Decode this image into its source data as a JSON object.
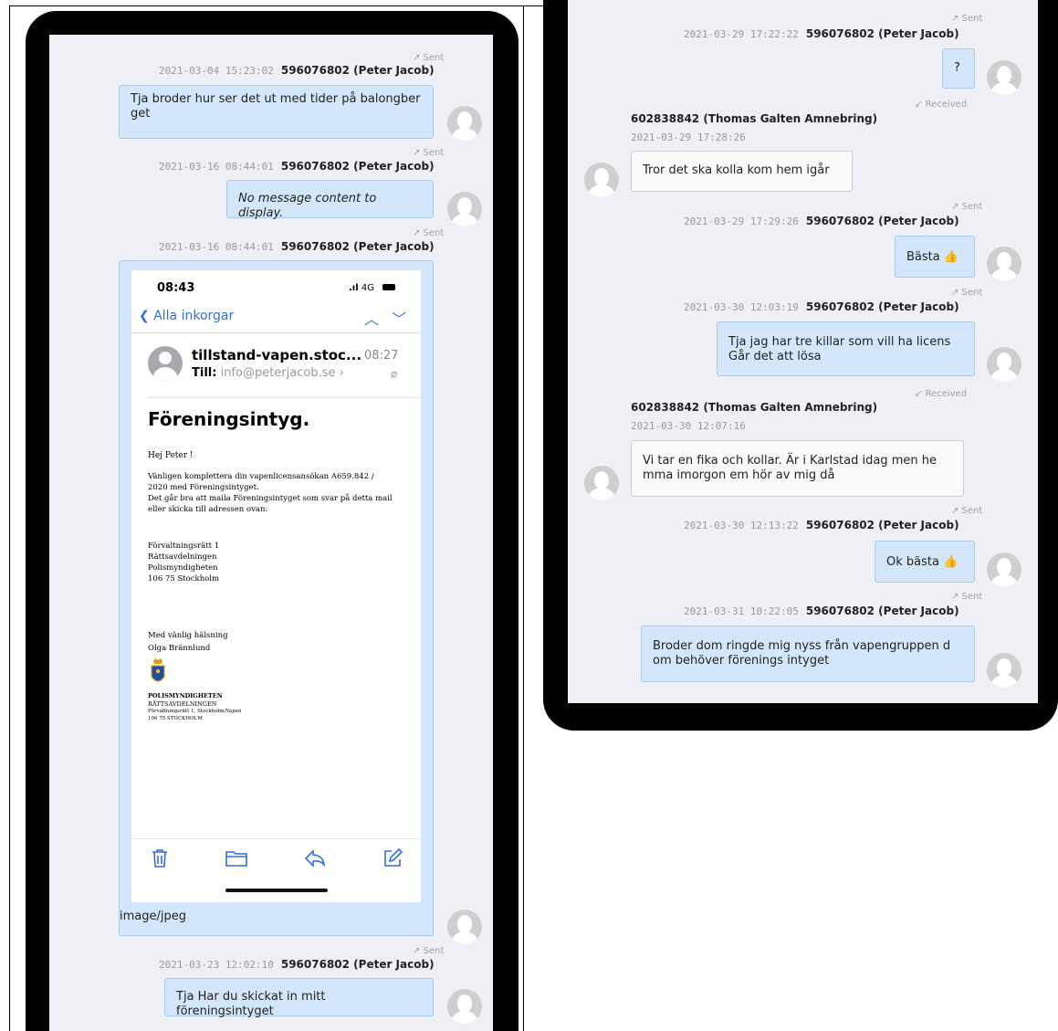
{
  "left": {
    "messages": [
      {
        "status": "↗ Sent",
        "timestamp": "2021-03-04 15:23:02",
        "sender": "596076802 (Peter Jacob)",
        "text": "Tja broder hur ser det ut med tider på balongber get"
      },
      {
        "status": "↗ Sent",
        "timestamp": "2021-03-16 08:44:01",
        "sender": "596076802 (Peter Jacob)",
        "text": "No message content to display."
      },
      {
        "status": "↗ Sent",
        "timestamp": "2021-03-16 08:44:01",
        "sender": "596076802 (Peter Jacob)",
        "attachment_type": "image/jpeg"
      },
      {
        "status": "↗ Sent",
        "timestamp": "2021-03-23 12:02:10",
        "sender": "596076802 (Peter Jacob)",
        "text": "Tja Har du skickat in mitt föreningsintyget"
      }
    ]
  },
  "mail": {
    "time": "08:43",
    "signal": "4G",
    "back_label": "Alla inkorgar",
    "from": "tillstand-vapen.stoc...",
    "from_time": "08:27",
    "to_label": "Till:",
    "to_value": "info@peterjacob.se",
    "subject": "Föreningsintyg.",
    "greeting": "Hej Peter !",
    "body_lines": [
      "Vänligen komplettera din vapenlicensansökan  A659.842 /",
      "2020  med  Föreningsintyget.",
      "Det går bra att maila Föreningsintyget som svar på detta mail",
      "eller skicka till adressen ovan:"
    ],
    "address_lines": [
      "Förvaltningsrätt 1",
      "Rättsavdelningen",
      "Polismyndigheten",
      "106 75 Stockholm"
    ],
    "closing": "Med vänlig hälsning",
    "signer": "Olga Brännlund",
    "org_name": "POLISMYNDIGHETEN",
    "org_dept": "RÄTTSAVDELNINGEN",
    "org_addr": "Förvaltningsrätt 1, Stockholm/Vapen",
    "org_city": "106 75 STOCKHOLM",
    "icons": [
      "trash-icon",
      "folder-icon",
      "reply-icon",
      "compose-icon"
    ]
  },
  "right": {
    "messages": [
      {
        "status": "↗ Sent",
        "timestamp": "2021-03-29 17:22:22",
        "sender": "596076802 (Peter Jacob)",
        "text": "?"
      },
      {
        "status": "↙ Received",
        "timestamp": "2021-03-29 17:28:26",
        "sender": "602838842 (Thomas Galten Amnebring)",
        "text": "Tror det ska kolla kom hem igår"
      },
      {
        "status": "↗ Sent",
        "timestamp": "2021-03-29 17:29:26",
        "sender": "596076802 (Peter Jacob)",
        "text": "Bästa 👍"
      },
      {
        "status": "↗ Sent",
        "timestamp": "2021-03-30 12:03:19",
        "sender": "596076802 (Peter Jacob)",
        "text": "Tja jag har tre killar som vill ha licens Går det att lösa"
      },
      {
        "status": "↙ Received",
        "timestamp": "2021-03-30 12:07:16",
        "sender": "602838842 (Thomas Galten Amnebring)",
        "text": "Vi tar en fika och kollar. Är i Karlstad idag men he mma imorgon em hör av mig då"
      },
      {
        "status": "↗ Sent",
        "timestamp": "2021-03-30 12:13:22",
        "sender": "596076802 (Peter Jacob)",
        "text": "Ok bästa 👍"
      },
      {
        "status": "↗ Sent",
        "timestamp": "2021-03-31 10:22:05",
        "sender": "596076802 (Peter Jacob)",
        "text": "Broder dom ringde mig nyss från vapengruppen d om behöver förenings intyget"
      }
    ]
  }
}
